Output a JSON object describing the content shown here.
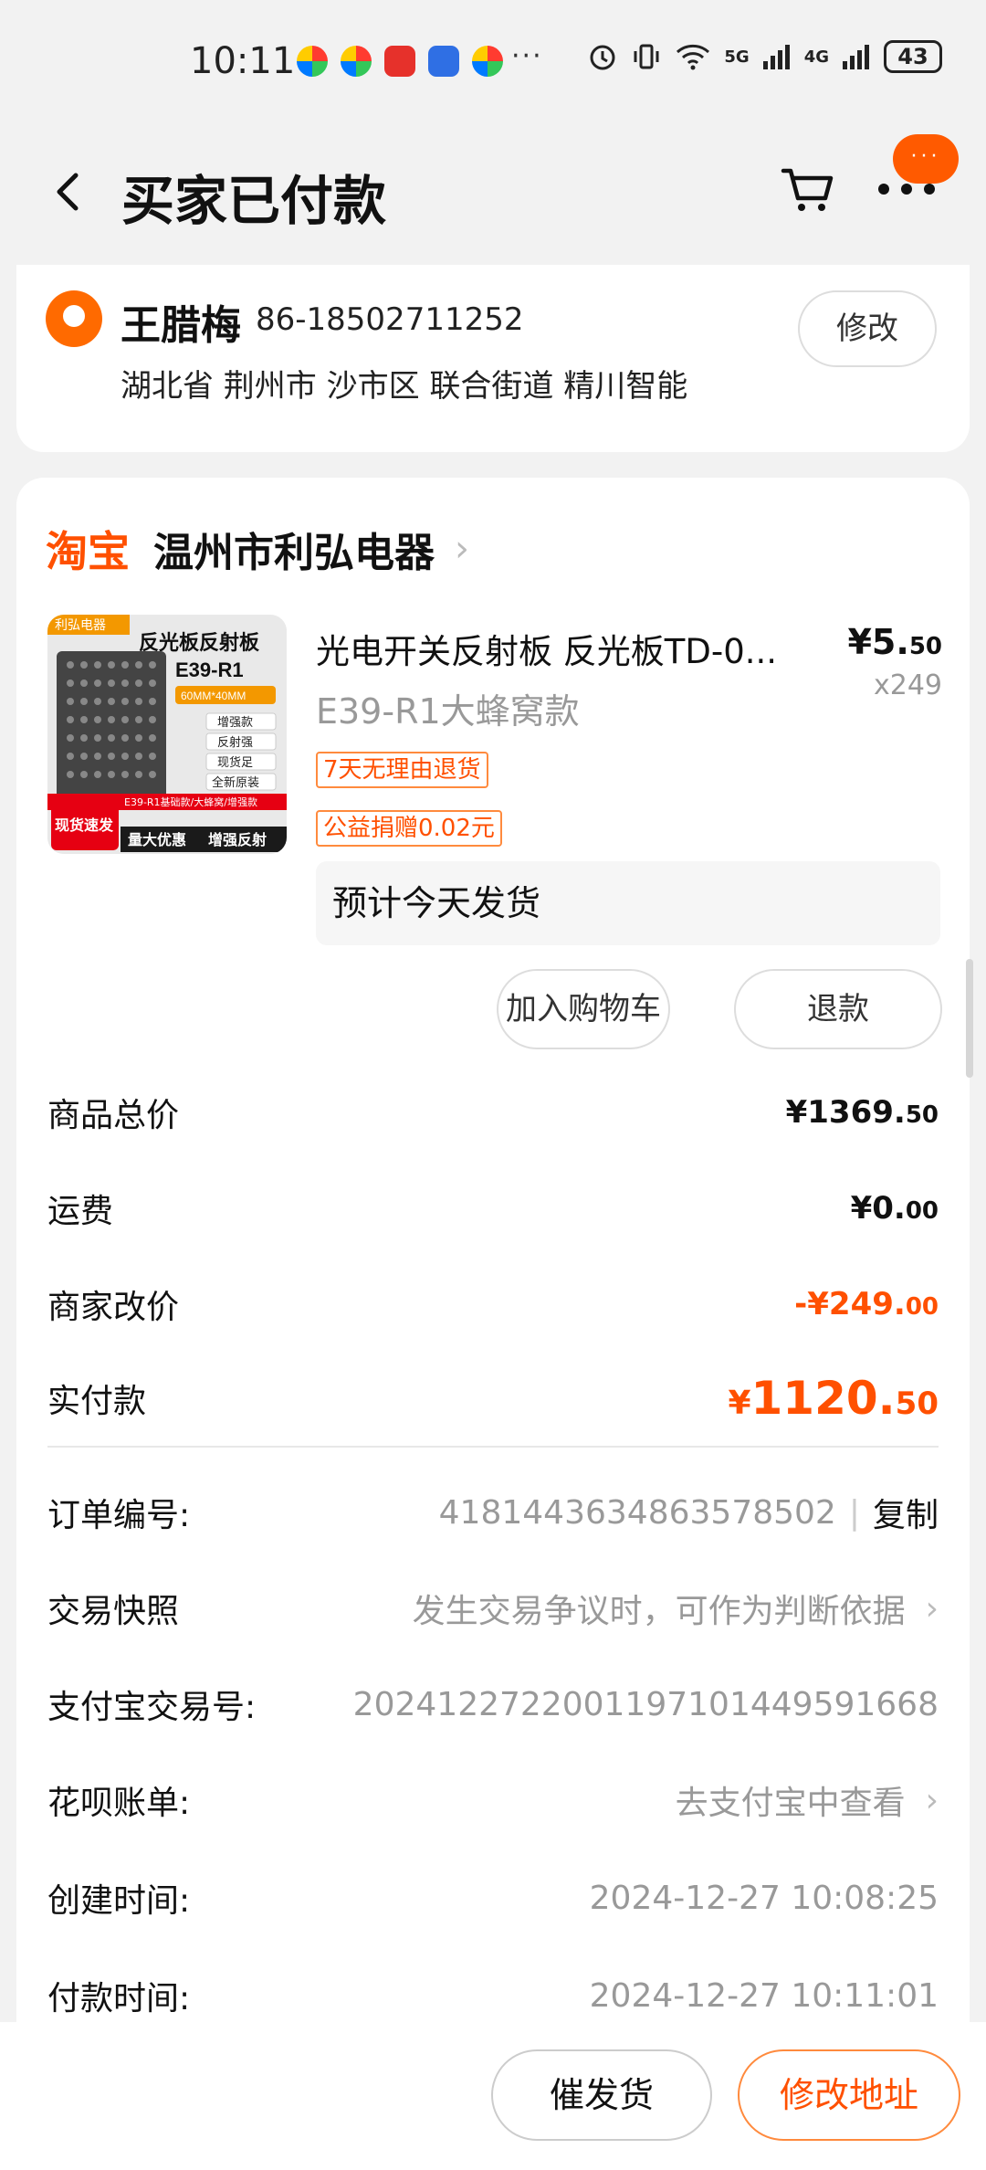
{
  "status_bar": {
    "time": "10:11",
    "dots": "···",
    "network_5g": "5G",
    "network_4g": "4G",
    "battery": "43"
  },
  "nav": {
    "title": "买家已付款",
    "badge": "···"
  },
  "address": {
    "name": "王腊梅",
    "phone": "86-18502711252",
    "line": "湖北省 荆州市 沙市区 联合街道 精川智能",
    "edit_label": "修改"
  },
  "shop": {
    "logo": "淘宝",
    "name": "温州市利弘电器"
  },
  "product": {
    "title": "光电开关反射板 反光板TD-0...",
    "price_int": "¥5.",
    "price_dec": "50",
    "qty": "x249",
    "spec": "E39-R1大蜂窝款",
    "tags": [
      "7天无理由退货",
      "公益捐赠0.02元"
    ],
    "ship_note": "预计今天发货",
    "image_text": {
      "brand": "利弘电器",
      "headline": "反光板反射板",
      "model": "E39-R1",
      "size": "60MM*40MM",
      "features": [
        "增强款",
        "反射强",
        "现货足",
        "全新原装"
      ],
      "badge": "现货速发",
      "strip": "E39-R1基础款/大蜂窝/增强款",
      "footer": [
        "量大优惠",
        "增强反射"
      ]
    },
    "add_cart_label": "加入购物车",
    "refund_label": "退款"
  },
  "summary": {
    "goods_total_label": "商品总价",
    "goods_total_int": "¥1369.",
    "goods_total_dec": "50",
    "shipping_label": "运费",
    "shipping_int": "¥0.",
    "shipping_dec": "00",
    "discount_label": "商家改价",
    "discount_int": "-¥249.",
    "discount_dec": "00",
    "paid_label": "实付款",
    "paid_cur": "¥",
    "paid_int": "1120.",
    "paid_dec": "50"
  },
  "info": {
    "order_no_label": "订单编号:",
    "order_no": "4181443634863578502",
    "copy_label": "复制",
    "snapshot_label": "交易快照",
    "snapshot_value": "发生交易争议时，可作为判断依据",
    "alipay_no_label": "支付宝交易号:",
    "alipay_no": "2024122722001197101449591668",
    "huabei_label": "花呗账单:",
    "huabei_value": "去支付宝中查看",
    "created_label": "创建时间:",
    "created_value": "2024-12-27 10:08:25",
    "paid_time_label": "付款时间:",
    "paid_time_value": "2024-12-27 10:11:01"
  },
  "bottom": {
    "urge_label": "催发货",
    "change_addr_label": "修改地址"
  },
  "colors": {
    "accent": "#ff5000",
    "badge": "#ff5a00",
    "muted": "#999999"
  }
}
